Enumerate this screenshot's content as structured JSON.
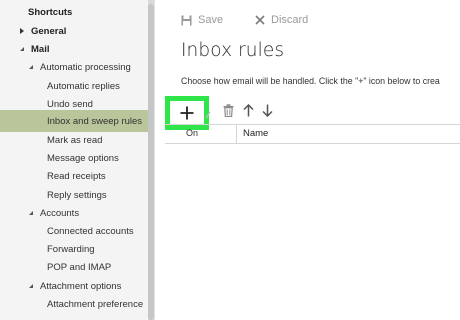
{
  "toolbar": {
    "save_label": "Save",
    "discard_label": "Discard"
  },
  "page": {
    "title": "Inbox rules",
    "description": "Choose how email will be handled. Click the \"+\" icon below to crea"
  },
  "nav": {
    "shortcuts": "Shortcuts",
    "general": "General",
    "mail": "Mail",
    "automatic_processing": "Automatic processing",
    "automatic_replies": "Automatic replies",
    "undo_send": "Undo send",
    "inbox_and_sweep_rules": "Inbox and sweep rules",
    "mark_as_read": "Mark as read",
    "message_options": "Message options",
    "read_receipts": "Read receipts",
    "reply_settings": "Reply settings",
    "accounts": "Accounts",
    "connected_accounts": "Connected accounts",
    "forwarding": "Forwarding",
    "pop_and_imap": "POP and IMAP",
    "attachment_options": "Attachment options",
    "attachment_preference": "Attachment preference"
  },
  "table": {
    "col_on": "On",
    "col_name": "Name"
  },
  "colors": {
    "selected_bg": "#b9c59a",
    "highlight_border": "#2ee64a"
  },
  "icons": [
    "save-icon",
    "close-icon",
    "plus-icon",
    "pencil-icon",
    "trash-icon",
    "arrow-up-icon",
    "arrow-down-icon"
  ]
}
